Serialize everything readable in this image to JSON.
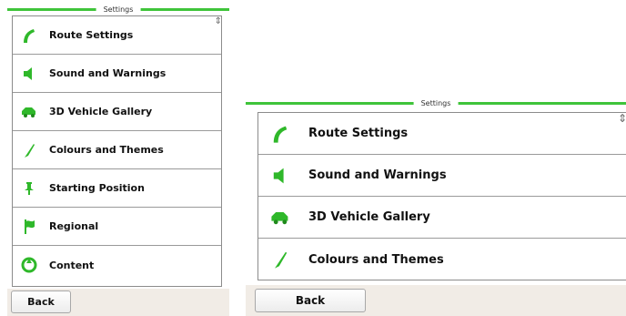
{
  "accent_color": "#3fc43a",
  "left_screen": {
    "title": "Settings",
    "back_label": "Back",
    "menu_items": [
      {
        "label": "Route Settings",
        "icon": "route-icon"
      },
      {
        "label": "Sound and Warnings",
        "icon": "speaker-icon"
      },
      {
        "label": "3D Vehicle Gallery",
        "icon": "vehicle-icon"
      },
      {
        "label": "Colours and Themes",
        "icon": "brush-icon"
      },
      {
        "label": "Starting Position",
        "icon": "pin-icon"
      },
      {
        "label": "Regional",
        "icon": "flag-icon"
      },
      {
        "label": "Content",
        "icon": "content-icon"
      }
    ]
  },
  "right_screen": {
    "title": "Settings",
    "back_label": "Back",
    "menu_items": [
      {
        "label": "Route Settings",
        "icon": "route-icon"
      },
      {
        "label": "Sound and Warnings",
        "icon": "speaker-icon"
      },
      {
        "label": "3D Vehicle Gallery",
        "icon": "vehicle-icon"
      },
      {
        "label": "Colours and Themes",
        "icon": "brush-icon"
      }
    ]
  }
}
